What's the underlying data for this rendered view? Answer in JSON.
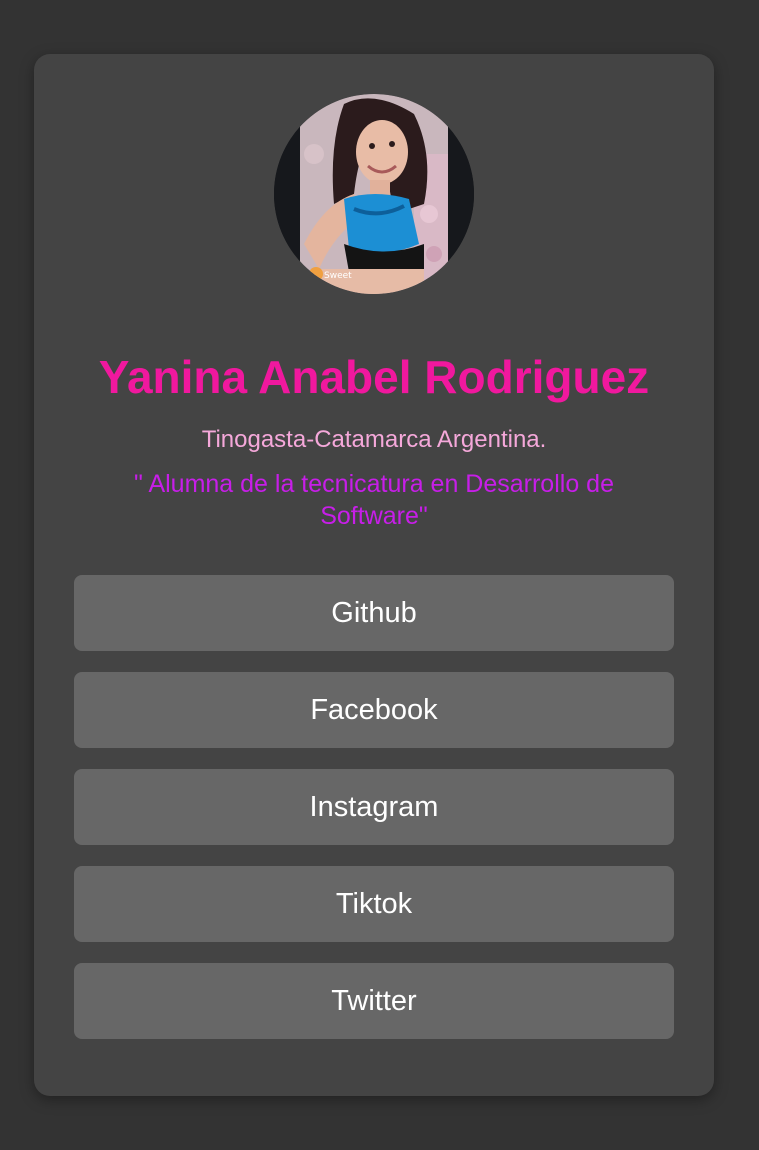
{
  "profile": {
    "name": "Yanina Anabel Rodriguez",
    "location": "Tinogasta-Catamarca Argentina.",
    "bio": "\" Alumna de la tecnicatura en Desarrollo de Software\"",
    "photo_caption": "Sweet"
  },
  "links": [
    {
      "label": "Github"
    },
    {
      "label": "Facebook"
    },
    {
      "label": "Instagram"
    },
    {
      "label": "Tiktok"
    },
    {
      "label": "Twitter"
    }
  ],
  "colors": {
    "page_background": "#333333",
    "card_background": "#444444",
    "button_background": "#676767",
    "name": "#f0189e",
    "location": "#f5a8da",
    "bio": "#c71ee8",
    "button_text": "#ffffff"
  }
}
